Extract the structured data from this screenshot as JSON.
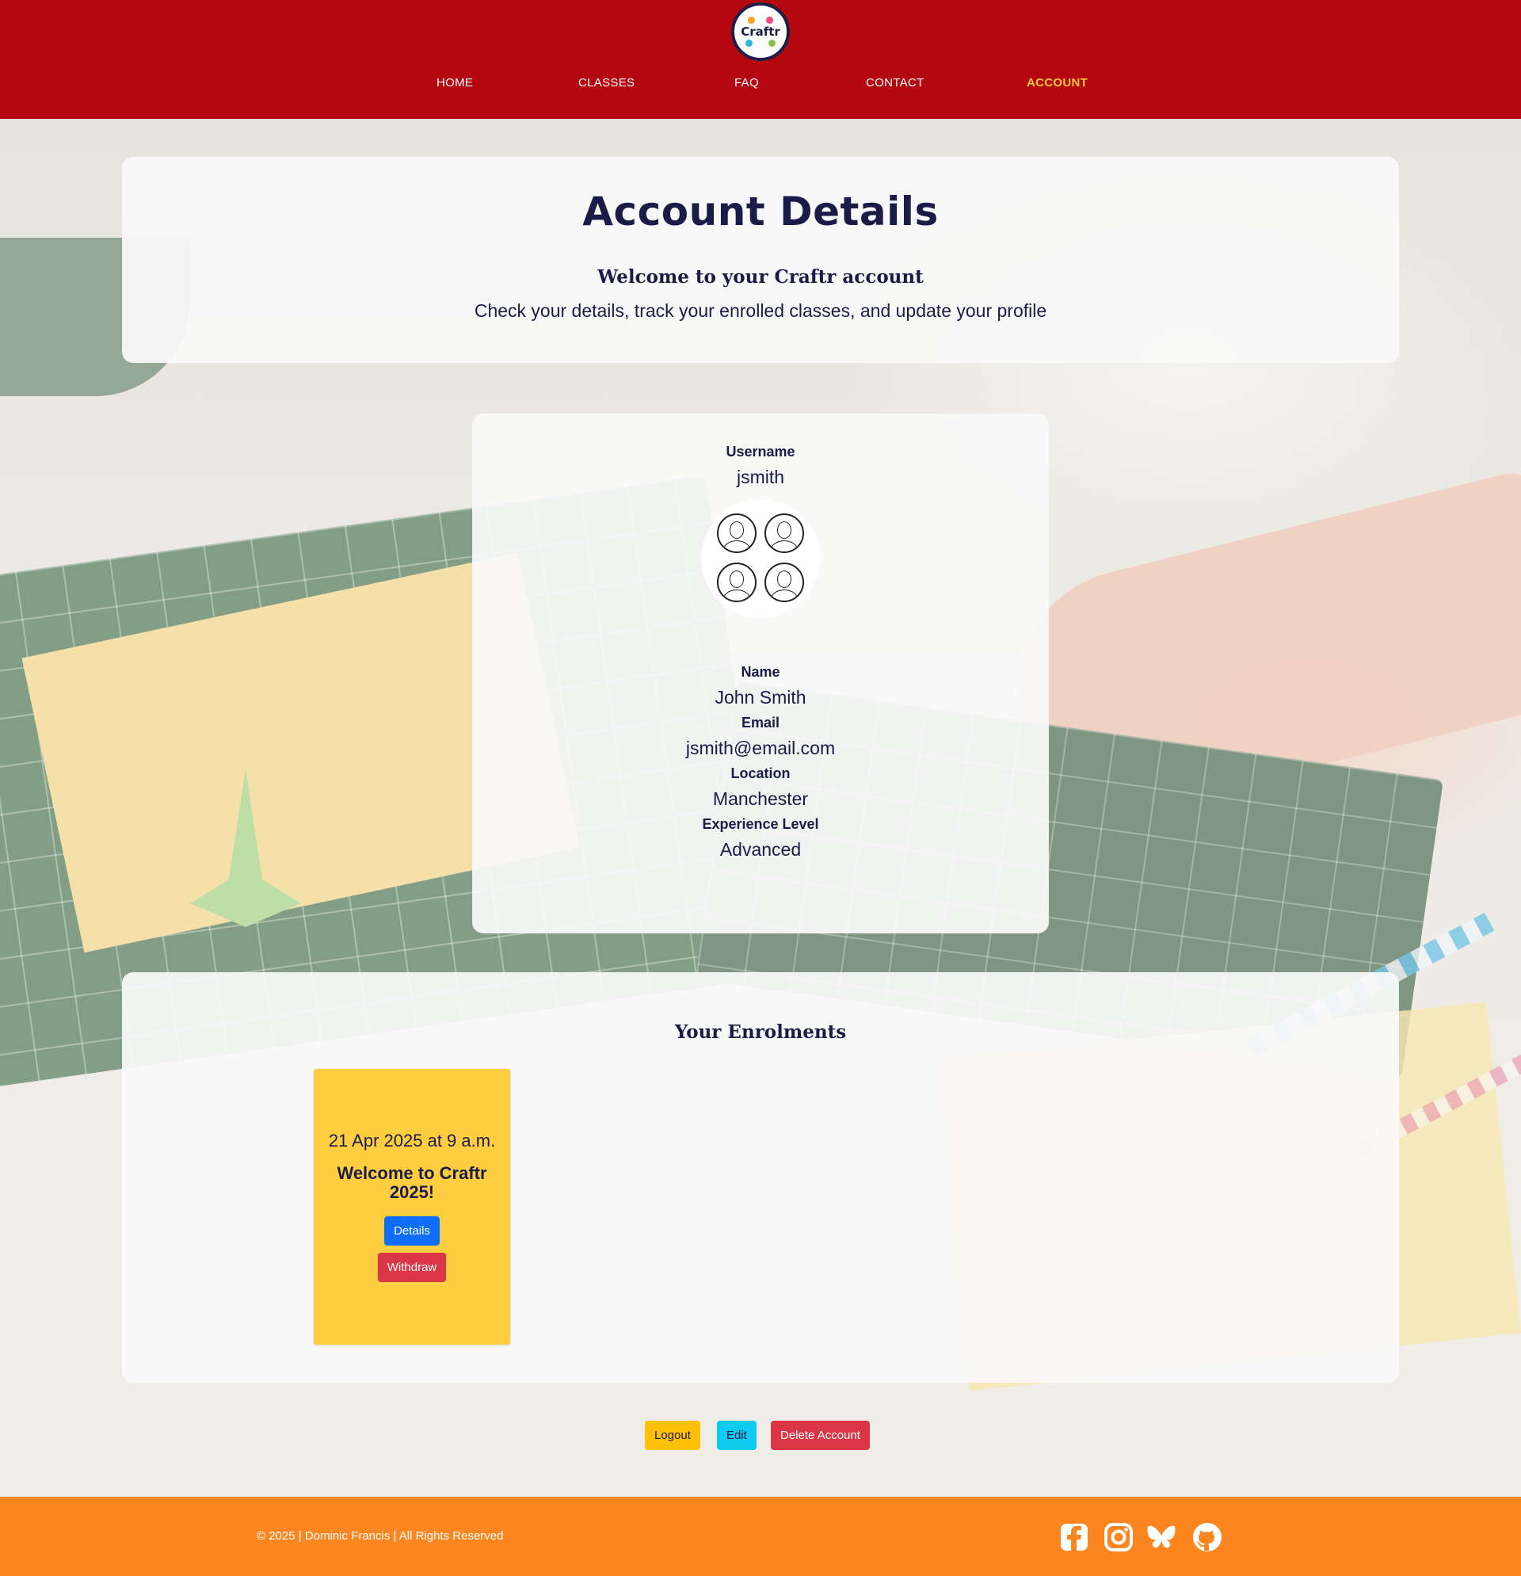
{
  "brand": {
    "logo_text": "Craftr"
  },
  "nav": {
    "items": [
      {
        "label": "HOME"
      },
      {
        "label": "CLASSES"
      },
      {
        "label": "FAQ"
      },
      {
        "label": "CONTACT"
      },
      {
        "label": "ACCOUNT",
        "active": true
      }
    ]
  },
  "hero": {
    "title": "Account Details",
    "subtitle": "Welcome to your Craftr account",
    "description": "Check your details, track your enrolled classes, and update your profile"
  },
  "profile": {
    "username_label": "Username",
    "username": "jsmith",
    "name_label": "Name",
    "name": "John Smith",
    "email_label": "Email",
    "email": "jsmith@email.com",
    "location_label": "Location",
    "location": "Manchester",
    "experience_label": "Experience Level",
    "experience": "Advanced"
  },
  "enrolments": {
    "heading": "Your Enrolments",
    "items": [
      {
        "date": "21 Apr 2025 at 9 a.m.",
        "title": "Welcome to Craftr 2025!",
        "details_label": "Details",
        "withdraw_label": "Withdraw"
      }
    ]
  },
  "actions": {
    "logout_label": "Logout",
    "edit_label": "Edit",
    "delete_label": "Delete Account"
  },
  "footer": {
    "copyright": "© 2025 | Dominic Francis | All Rights Reserved",
    "social_icons": [
      "facebook-icon",
      "instagram-icon",
      "bluesky-icon",
      "github-icon"
    ]
  },
  "colors": {
    "header": "#b4070f",
    "footer": "#fd8621",
    "nav_active": "#ffc83d",
    "card": "#ffcd40",
    "text_dark": "#1b1b48"
  }
}
